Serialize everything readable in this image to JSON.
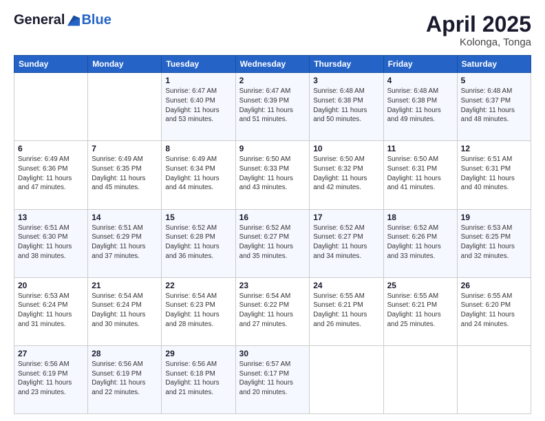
{
  "logo": {
    "general": "General",
    "blue": "Blue"
  },
  "title": "April 2025",
  "location": "Kolonga, Tonga",
  "days_of_week": [
    "Sunday",
    "Monday",
    "Tuesday",
    "Wednesday",
    "Thursday",
    "Friday",
    "Saturday"
  ],
  "weeks": [
    [
      {
        "day": "",
        "info": ""
      },
      {
        "day": "",
        "info": ""
      },
      {
        "day": "1",
        "info": "Sunrise: 6:47 AM\nSunset: 6:40 PM\nDaylight: 11 hours and 53 minutes."
      },
      {
        "day": "2",
        "info": "Sunrise: 6:47 AM\nSunset: 6:39 PM\nDaylight: 11 hours and 51 minutes."
      },
      {
        "day": "3",
        "info": "Sunrise: 6:48 AM\nSunset: 6:38 PM\nDaylight: 11 hours and 50 minutes."
      },
      {
        "day": "4",
        "info": "Sunrise: 6:48 AM\nSunset: 6:38 PM\nDaylight: 11 hours and 49 minutes."
      },
      {
        "day": "5",
        "info": "Sunrise: 6:48 AM\nSunset: 6:37 PM\nDaylight: 11 hours and 48 minutes."
      }
    ],
    [
      {
        "day": "6",
        "info": "Sunrise: 6:49 AM\nSunset: 6:36 PM\nDaylight: 11 hours and 47 minutes."
      },
      {
        "day": "7",
        "info": "Sunrise: 6:49 AM\nSunset: 6:35 PM\nDaylight: 11 hours and 45 minutes."
      },
      {
        "day": "8",
        "info": "Sunrise: 6:49 AM\nSunset: 6:34 PM\nDaylight: 11 hours and 44 minutes."
      },
      {
        "day": "9",
        "info": "Sunrise: 6:50 AM\nSunset: 6:33 PM\nDaylight: 11 hours and 43 minutes."
      },
      {
        "day": "10",
        "info": "Sunrise: 6:50 AM\nSunset: 6:32 PM\nDaylight: 11 hours and 42 minutes."
      },
      {
        "day": "11",
        "info": "Sunrise: 6:50 AM\nSunset: 6:31 PM\nDaylight: 11 hours and 41 minutes."
      },
      {
        "day": "12",
        "info": "Sunrise: 6:51 AM\nSunset: 6:31 PM\nDaylight: 11 hours and 40 minutes."
      }
    ],
    [
      {
        "day": "13",
        "info": "Sunrise: 6:51 AM\nSunset: 6:30 PM\nDaylight: 11 hours and 38 minutes."
      },
      {
        "day": "14",
        "info": "Sunrise: 6:51 AM\nSunset: 6:29 PM\nDaylight: 11 hours and 37 minutes."
      },
      {
        "day": "15",
        "info": "Sunrise: 6:52 AM\nSunset: 6:28 PM\nDaylight: 11 hours and 36 minutes."
      },
      {
        "day": "16",
        "info": "Sunrise: 6:52 AM\nSunset: 6:27 PM\nDaylight: 11 hours and 35 minutes."
      },
      {
        "day": "17",
        "info": "Sunrise: 6:52 AM\nSunset: 6:27 PM\nDaylight: 11 hours and 34 minutes."
      },
      {
        "day": "18",
        "info": "Sunrise: 6:52 AM\nSunset: 6:26 PM\nDaylight: 11 hours and 33 minutes."
      },
      {
        "day": "19",
        "info": "Sunrise: 6:53 AM\nSunset: 6:25 PM\nDaylight: 11 hours and 32 minutes."
      }
    ],
    [
      {
        "day": "20",
        "info": "Sunrise: 6:53 AM\nSunset: 6:24 PM\nDaylight: 11 hours and 31 minutes."
      },
      {
        "day": "21",
        "info": "Sunrise: 6:54 AM\nSunset: 6:24 PM\nDaylight: 11 hours and 30 minutes."
      },
      {
        "day": "22",
        "info": "Sunrise: 6:54 AM\nSunset: 6:23 PM\nDaylight: 11 hours and 28 minutes."
      },
      {
        "day": "23",
        "info": "Sunrise: 6:54 AM\nSunset: 6:22 PM\nDaylight: 11 hours and 27 minutes."
      },
      {
        "day": "24",
        "info": "Sunrise: 6:55 AM\nSunset: 6:21 PM\nDaylight: 11 hours and 26 minutes."
      },
      {
        "day": "25",
        "info": "Sunrise: 6:55 AM\nSunset: 6:21 PM\nDaylight: 11 hours and 25 minutes."
      },
      {
        "day": "26",
        "info": "Sunrise: 6:55 AM\nSunset: 6:20 PM\nDaylight: 11 hours and 24 minutes."
      }
    ],
    [
      {
        "day": "27",
        "info": "Sunrise: 6:56 AM\nSunset: 6:19 PM\nDaylight: 11 hours and 23 minutes."
      },
      {
        "day": "28",
        "info": "Sunrise: 6:56 AM\nSunset: 6:19 PM\nDaylight: 11 hours and 22 minutes."
      },
      {
        "day": "29",
        "info": "Sunrise: 6:56 AM\nSunset: 6:18 PM\nDaylight: 11 hours and 21 minutes."
      },
      {
        "day": "30",
        "info": "Sunrise: 6:57 AM\nSunset: 6:17 PM\nDaylight: 11 hours and 20 minutes."
      },
      {
        "day": "",
        "info": ""
      },
      {
        "day": "",
        "info": ""
      },
      {
        "day": "",
        "info": ""
      }
    ]
  ]
}
